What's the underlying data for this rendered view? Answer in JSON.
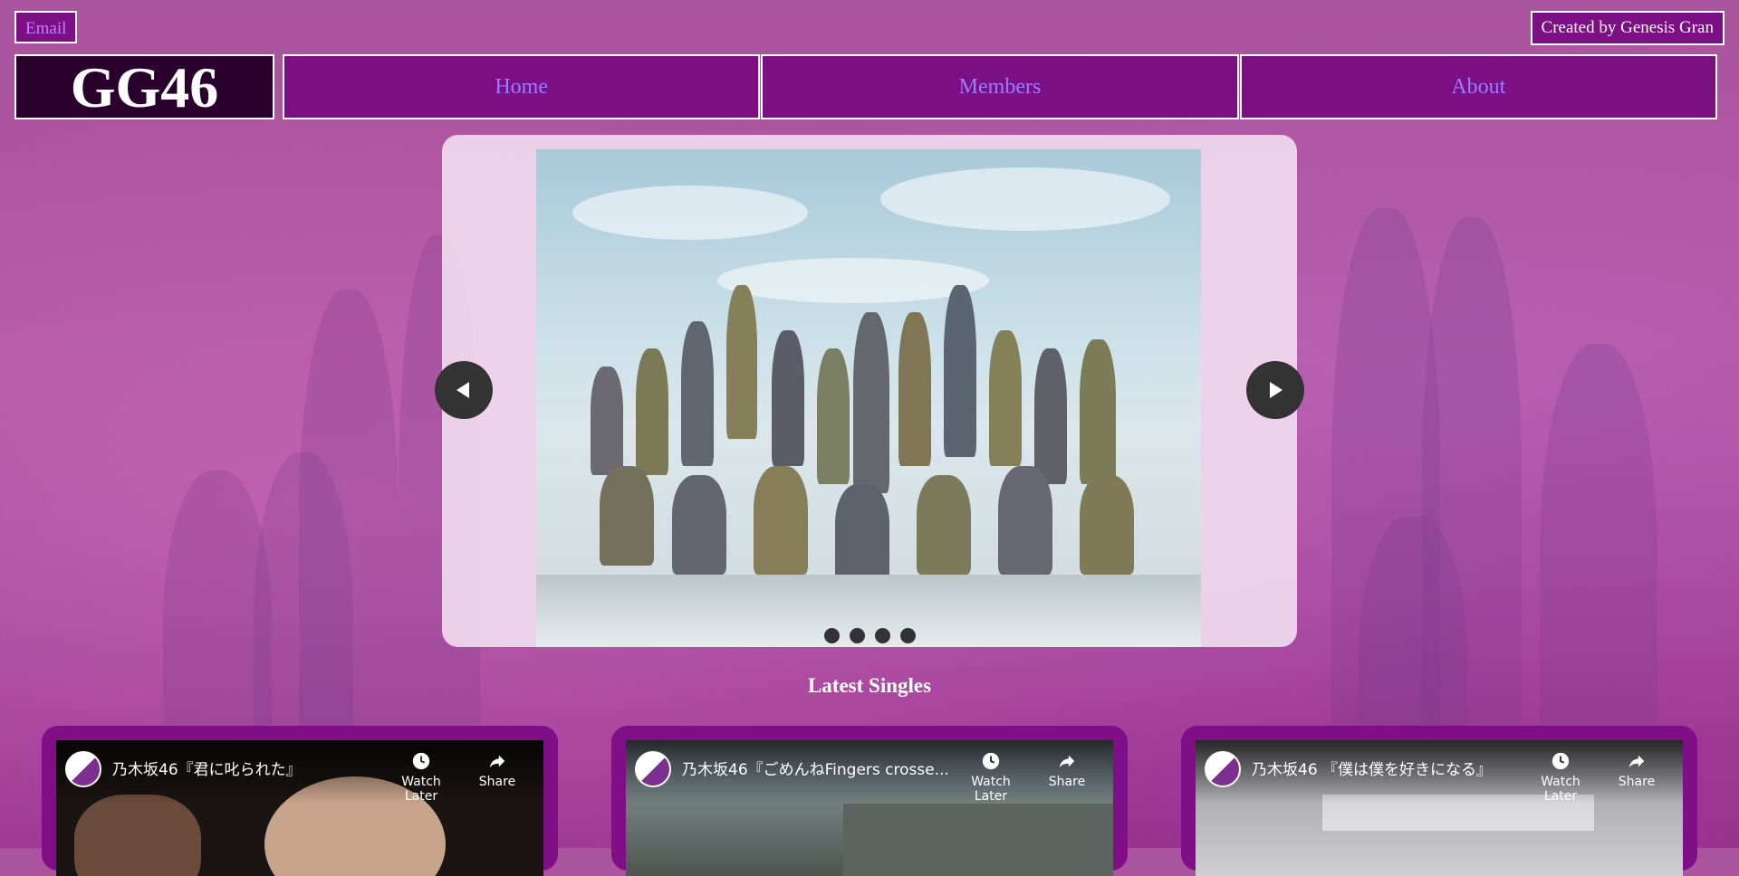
{
  "header": {
    "email_label": "Email",
    "credit_label": "Created by Genesis Gran",
    "logo_text": "GG46"
  },
  "nav": {
    "items": [
      {
        "label": "Home"
      },
      {
        "label": "Members"
      },
      {
        "label": "About"
      }
    ]
  },
  "carousel": {
    "slide_count": 4,
    "prev_icon": "left-arrow-icon",
    "next_icon": "right-arrow-icon"
  },
  "latest_singles": {
    "title": "Latest Singles",
    "videos": [
      {
        "title": "乃木坂46『君に叱られた』",
        "watch_later": "Watch Later",
        "share": "Share"
      },
      {
        "title": "乃木坂46『ごめんねFingers crosse...",
        "watch_later": "Watch Later",
        "share": "Share"
      },
      {
        "title": "乃木坂46 『僕は僕を好きになる』",
        "watch_later": "Watch Later",
        "share": "Share"
      }
    ]
  },
  "colors": {
    "nav_bg": "#7d0f84",
    "nav_text": "#9b7bff",
    "logo_bg": "#2a002c",
    "card_bg": "#800e86"
  }
}
